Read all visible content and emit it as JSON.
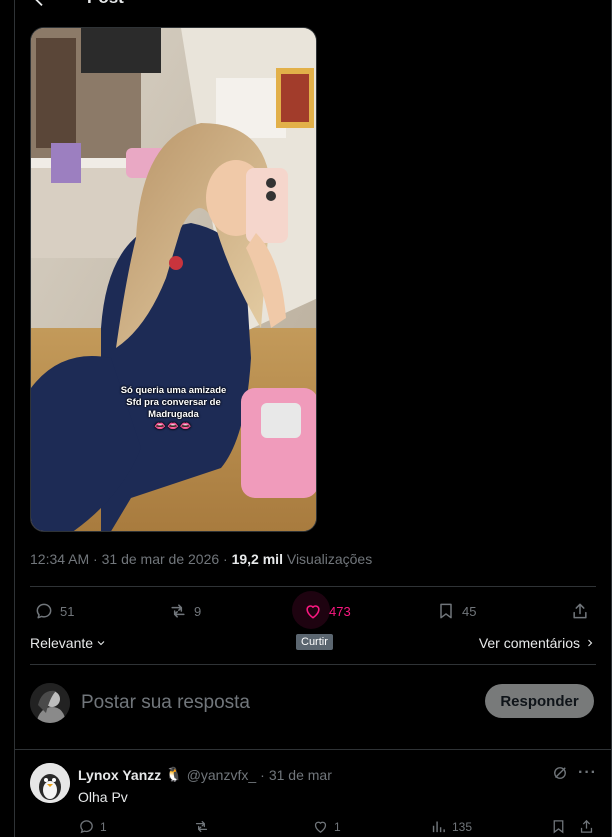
{
  "header": {
    "title": "Post",
    "back_icon": "arrow-left-icon"
  },
  "media": {
    "caption_lines": [
      "Só queria uma amizade",
      "Sfd pra conversar de",
      "Madrugada"
    ],
    "caption_emoji": "👄👄👄"
  },
  "meta": {
    "time": "12:34 AM",
    "separator": " · ",
    "date": "31 de mar de 2026",
    "views_count": "19,2 mil",
    "views_label": "Visualizações"
  },
  "actions": {
    "replies": "51",
    "reposts": "9",
    "likes": "473",
    "bookmarks": "45",
    "like_tooltip": "Curtir"
  },
  "sort": {
    "relevance_label": "Relevante",
    "view_comments_label": "Ver comentários"
  },
  "reply_box": {
    "placeholder": "Postar sua resposta",
    "button_label": "Responder"
  },
  "comment": {
    "name": "Lynox Yanzz",
    "badge_emoji": "🐧",
    "handle": "@yanzvfx_",
    "dot": "·",
    "date": "31 de mar",
    "text": "Olha Pv",
    "replies": "1",
    "reposts": "",
    "likes": "1",
    "views": "135"
  },
  "colors": {
    "background": "#000000",
    "text": "#e7e9ea",
    "muted": "#71767b",
    "border": "#2f3336",
    "like_pink": "#f91880",
    "button_gray": "#787a7a"
  }
}
